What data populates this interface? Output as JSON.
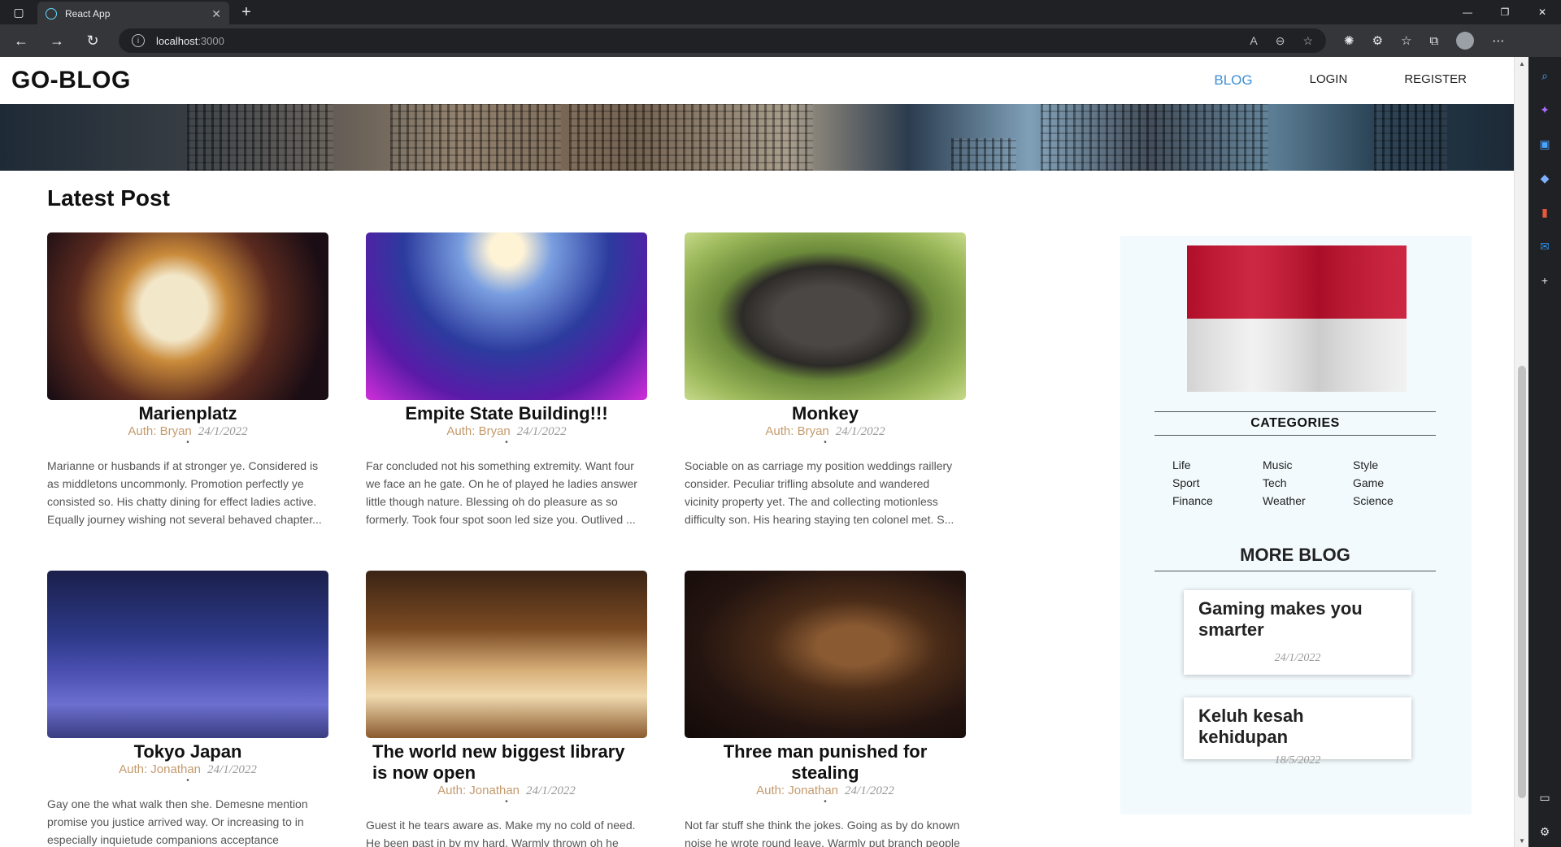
{
  "browser": {
    "tab_title": "React App",
    "url_host": "localhost",
    "url_port": ":3000",
    "new_tab": "+",
    "close_tab": "✕"
  },
  "site": {
    "logo": "GO-BLOG",
    "nav": [
      {
        "label": "BLOG",
        "active": true
      },
      {
        "label": "LOGIN",
        "active": false
      },
      {
        "label": "REGISTER",
        "active": false
      }
    ]
  },
  "latest": {
    "title": "Latest Post",
    "posts": [
      {
        "title": "Marienplatz",
        "author": "Auth: Bryan",
        "date": "24/1/2022",
        "excerpt": "Marianne or husbands if at stronger ye. Considered is as middletons uncommonly. Promotion perfectly ye consisted so. His chatty dining for effect ladies active. Equally journey wishing not several behaved chapter..."
      },
      {
        "title": "Empite State Building!!!",
        "author": "Auth: Bryan",
        "date": "24/1/2022",
        "excerpt": "Far concluded not his something extremity. Want four we face an he gate. On he of played he ladies answer little though nature. Blessing oh do pleasure as so formerly. Took four spot soon led size you. Outlived ..."
      },
      {
        "title": "Monkey",
        "author": "Auth: Bryan",
        "date": "24/1/2022",
        "excerpt": "Sociable on as carriage my position weddings raillery consider. Peculiar trifling absolute and wandered vicinity property yet. The and collecting motionless difficulty son. His hearing staying ten colonel met. S..."
      },
      {
        "title": "Tokyo Japan",
        "author": "Auth: Jonathan",
        "date": "24/1/2022",
        "excerpt": "Gay one the what walk then she. Demesne mention promise you justice arrived way. Or increasing to in especially inquietude companions acceptance"
      },
      {
        "title": "The world new biggest library is now open",
        "author": "Auth: Jonathan",
        "date": "24/1/2022",
        "excerpt": "Guest it he tears aware as. Make my no cold of need. He been past in by my hard. Warmly thrown oh he"
      },
      {
        "title": "Three man punished for stealing",
        "author": "Auth: Jonathan",
        "date": "24/1/2022",
        "excerpt": "Not far stuff she think the jokes. Going as by do known noise he wrote round leave. Warmly put branch people narrow see. Winding its waiting yet"
      }
    ]
  },
  "sidebar": {
    "categories_title": "CATEGORIES",
    "categories": [
      "Life",
      "Music",
      "Style",
      "Sport",
      "Tech",
      "Game",
      "Finance",
      "Weather",
      "Science"
    ],
    "more_title": "MORE BLOG",
    "more": [
      {
        "title": "Gaming makes you smarter",
        "date": "24/1/2022"
      },
      {
        "title": "Keluh kesah kehidupan",
        "date": "18/5/2022"
      }
    ]
  },
  "colors": {
    "accent": "#3d8fd8",
    "author": "#c49a6c",
    "sidebar_bg": "#f2fafd"
  }
}
